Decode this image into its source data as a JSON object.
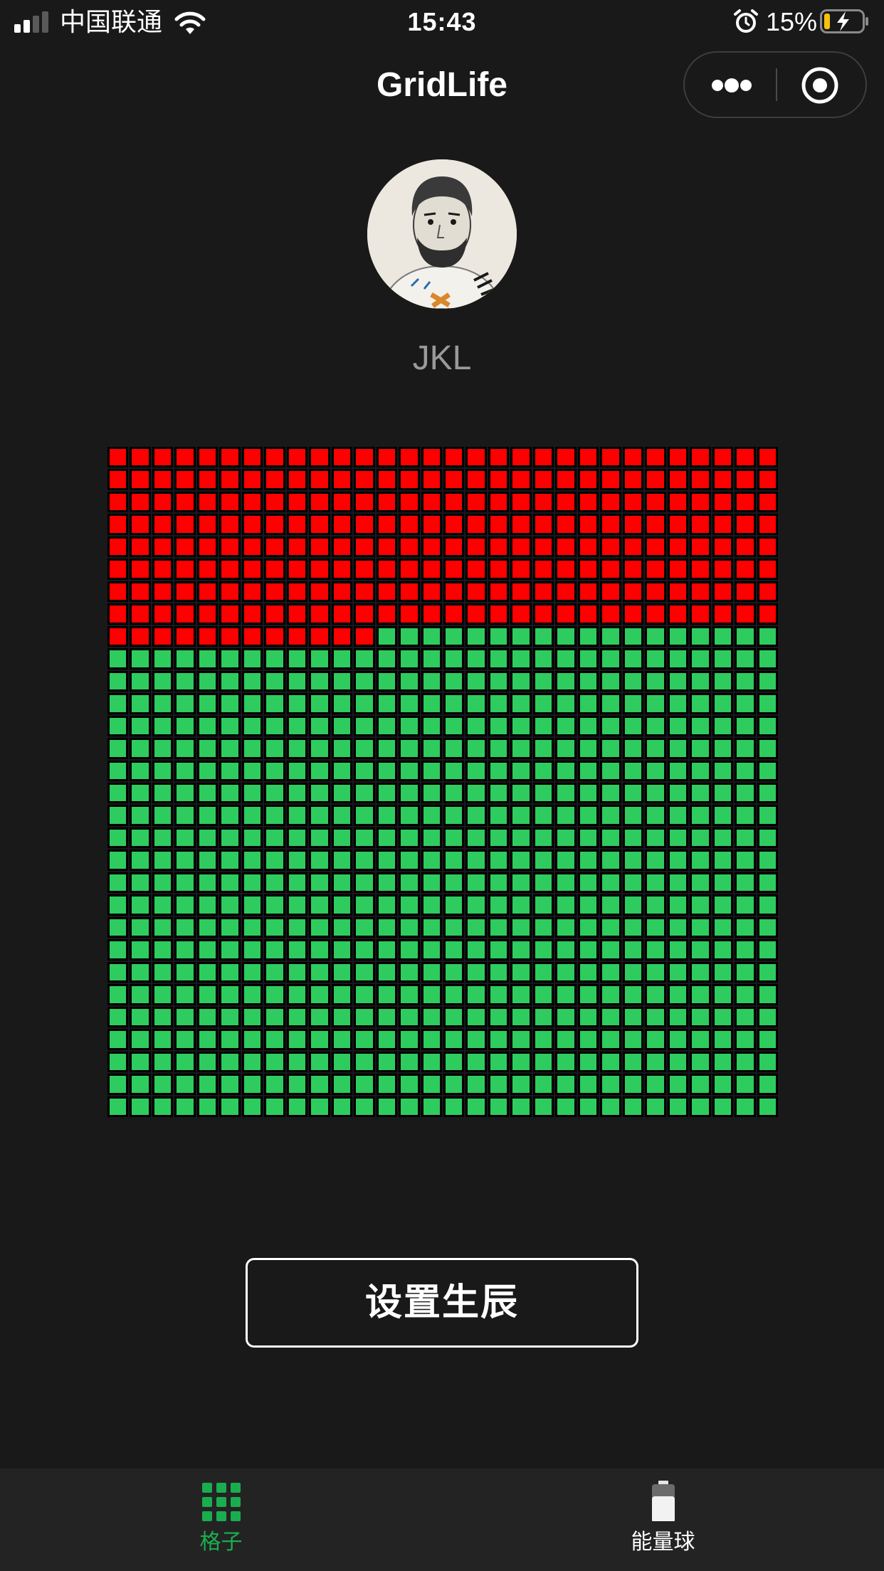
{
  "status_bar": {
    "carrier": "中国联通",
    "time": "15:43",
    "battery_percent": "15%",
    "battery_level": 0.15,
    "signal_bars": 2,
    "icons": [
      "signal-icon",
      "wifi-icon",
      "alarm-icon",
      "battery-charging-icon"
    ]
  },
  "nav": {
    "title": "GridLife",
    "icons": [
      "more-icon",
      "close-target-icon"
    ]
  },
  "profile": {
    "username": "JKL"
  },
  "grid": {
    "columns": 30,
    "rows": 30,
    "filled_cells": 252,
    "filled_color": "#ff0000",
    "empty_color": "#2ecc5e"
  },
  "button": {
    "set_birth_label": "设置生辰"
  },
  "tab_bar": {
    "tabs": [
      {
        "label": "格子",
        "icon": "grid-icon",
        "active": true,
        "color": "#1aad4f"
      },
      {
        "label": "能量球",
        "icon": "battery-icon",
        "active": false,
        "color": "#ffffff"
      }
    ]
  },
  "colors": {
    "background": "#191919",
    "tab_bar_background": "#232323",
    "accent": "#1aad4f"
  }
}
